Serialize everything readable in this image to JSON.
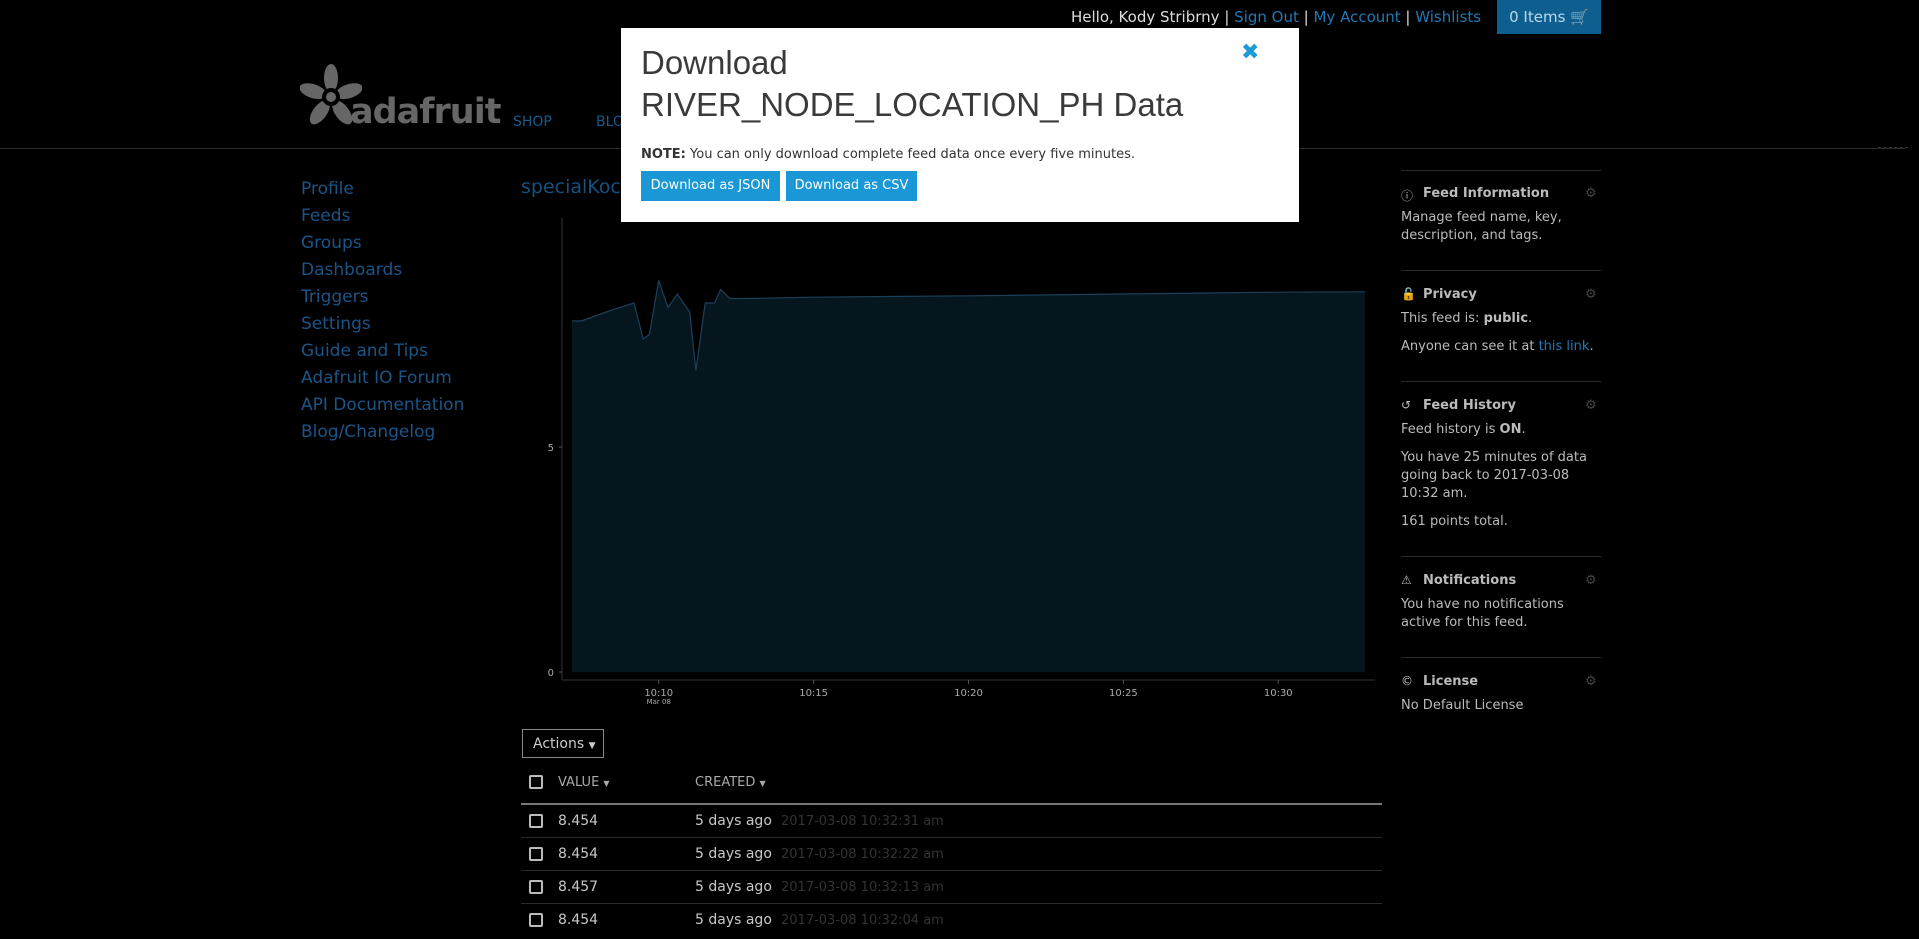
{
  "header": {
    "greeting": "Hello, Kody Stribrny",
    "sep1": "|",
    "sign_out": "Sign Out",
    "sep2": "|",
    "my_account": "My Account",
    "sep3": "|",
    "wishlists": "Wishlists",
    "cart_label": "0 Items",
    "logo_text": "adafruit",
    "nav": {
      "shop": "SHOP",
      "blog": "BLO"
    }
  },
  "sidebar_nav": [
    "Profile",
    "Feeds",
    "Groups",
    "Dashboards",
    "Triggers",
    "Settings",
    "Guide and Tips",
    "Adafruit IO Forum",
    "API Documentation",
    "Blog/Changelog"
  ],
  "feed": {
    "title_partial": "specialKoc"
  },
  "chart_data": {
    "type": "area",
    "y_ticks": [
      "0",
      "5"
    ],
    "x_ticks": [
      "10:10",
      "10:15",
      "10:20",
      "10:25",
      "10:30"
    ],
    "x_subtick": "Mar 08",
    "ylim": [
      0,
      10
    ],
    "x_range_minutes": [
      7.2,
      32.8
    ],
    "series": [
      {
        "x": [
          7.2,
          7.5,
          8.5,
          9.2,
          9.5,
          9.7,
          10.0,
          10.3,
          10.6,
          11.0,
          11.2,
          11.5,
          11.8,
          12.0,
          12.3,
          12.8,
          15.0,
          20.0,
          25.0,
          30.0,
          32.8
        ],
        "values": [
          7.8,
          7.8,
          8.05,
          8.2,
          7.4,
          7.5,
          8.7,
          8.1,
          8.4,
          8.0,
          6.7,
          8.2,
          8.2,
          8.5,
          8.3,
          8.3,
          8.33,
          8.36,
          8.4,
          8.44,
          8.45
        ]
      }
    ],
    "fill_color": "#06161f",
    "line_color": "#1c3f58"
  },
  "table": {
    "actions_label": "Actions",
    "headers": {
      "value": "VALUE",
      "created": "CREATED"
    },
    "rows": [
      {
        "value": "8.454",
        "ago": "5 days ago",
        "timestamp": "2017-03-08 10:32:31 am"
      },
      {
        "value": "8.454",
        "ago": "5 days ago",
        "timestamp": "2017-03-08 10:32:22 am"
      },
      {
        "value": "8.457",
        "ago": "5 days ago",
        "timestamp": "2017-03-08 10:32:13 am"
      },
      {
        "value": "8.454",
        "ago": "5 days ago",
        "timestamp": "2017-03-08 10:32:04 am"
      }
    ]
  },
  "right_sidebar": {
    "feed_info": {
      "title": "Feed Information",
      "text": "Manage feed name, key, description, and tags."
    },
    "privacy": {
      "title": "Privacy",
      "status_prefix": "This feed is: ",
      "status_value": "public",
      "status_suffix": ".",
      "access_prefix": "Anyone can see it at ",
      "access_link": "this link",
      "access_suffix": "."
    },
    "history": {
      "title": "Feed History",
      "status_prefix": "Feed history is ",
      "status_value": "ON",
      "status_suffix": ".",
      "summary": "You have 25 minutes of data going back to 2017-03-08 10:32 am.",
      "points": "161 points total."
    },
    "notifications": {
      "title": "Notifications",
      "text": "You have no notifications active for this feed."
    },
    "license": {
      "title": "License",
      "text": "No Default License"
    }
  },
  "modal": {
    "title_line1": "Download",
    "title_line2": "RIVER_NODE_LOCATION_PH Data",
    "note_label": "NOTE:",
    "note_text": " You can only download complete feed data once every five minutes.",
    "json_button": "Download as JSON",
    "csv_button": "Download as CSV",
    "close_glyph": "✖"
  }
}
